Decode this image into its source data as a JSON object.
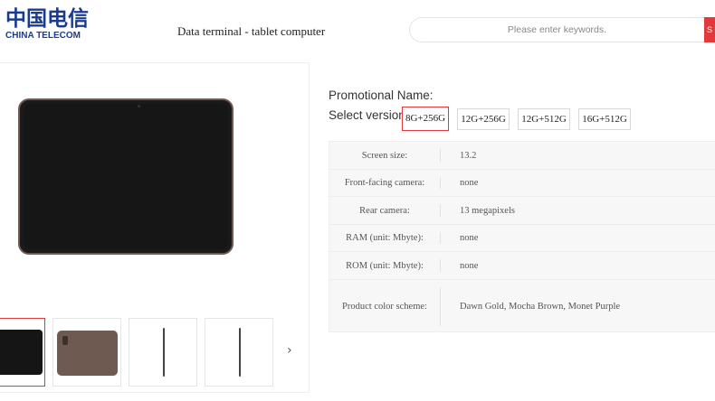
{
  "header": {
    "logo_cn": "中国电信",
    "logo_en": "CHINA TELECOM",
    "page_title": "Data terminal - tablet computer",
    "search_placeholder": "Please enter keywords.",
    "search_button": "S"
  },
  "product": {
    "promotional_label": "Promotional Name:",
    "version_label": "Select version:",
    "versions": [
      "8G+256G",
      "12G+256G",
      "12G+512G",
      "16G+512G"
    ],
    "selected_version": "8G+256G"
  },
  "specs": [
    {
      "key": "Screen size:",
      "value": "13.2"
    },
    {
      "key": "Front-facing camera:",
      "value": "none"
    },
    {
      "key": "Rear camera:",
      "value": "13 megapixels"
    },
    {
      "key": "RAM (unit: Mbyte):",
      "value": "none"
    },
    {
      "key": "ROM (unit: Mbyte):",
      "value": "none"
    },
    {
      "key": "Product color scheme:",
      "value": "Dawn Gold, Mocha Brown, Monet Purple"
    }
  ],
  "gallery": {
    "next_arrow": "›",
    "thumbnails": [
      "front view",
      "back view",
      "side view",
      "side view"
    ]
  },
  "colors": {
    "accent": "#e4393c",
    "brand": "#1b3c8c",
    "device_frame": "#6e5a4e"
  }
}
